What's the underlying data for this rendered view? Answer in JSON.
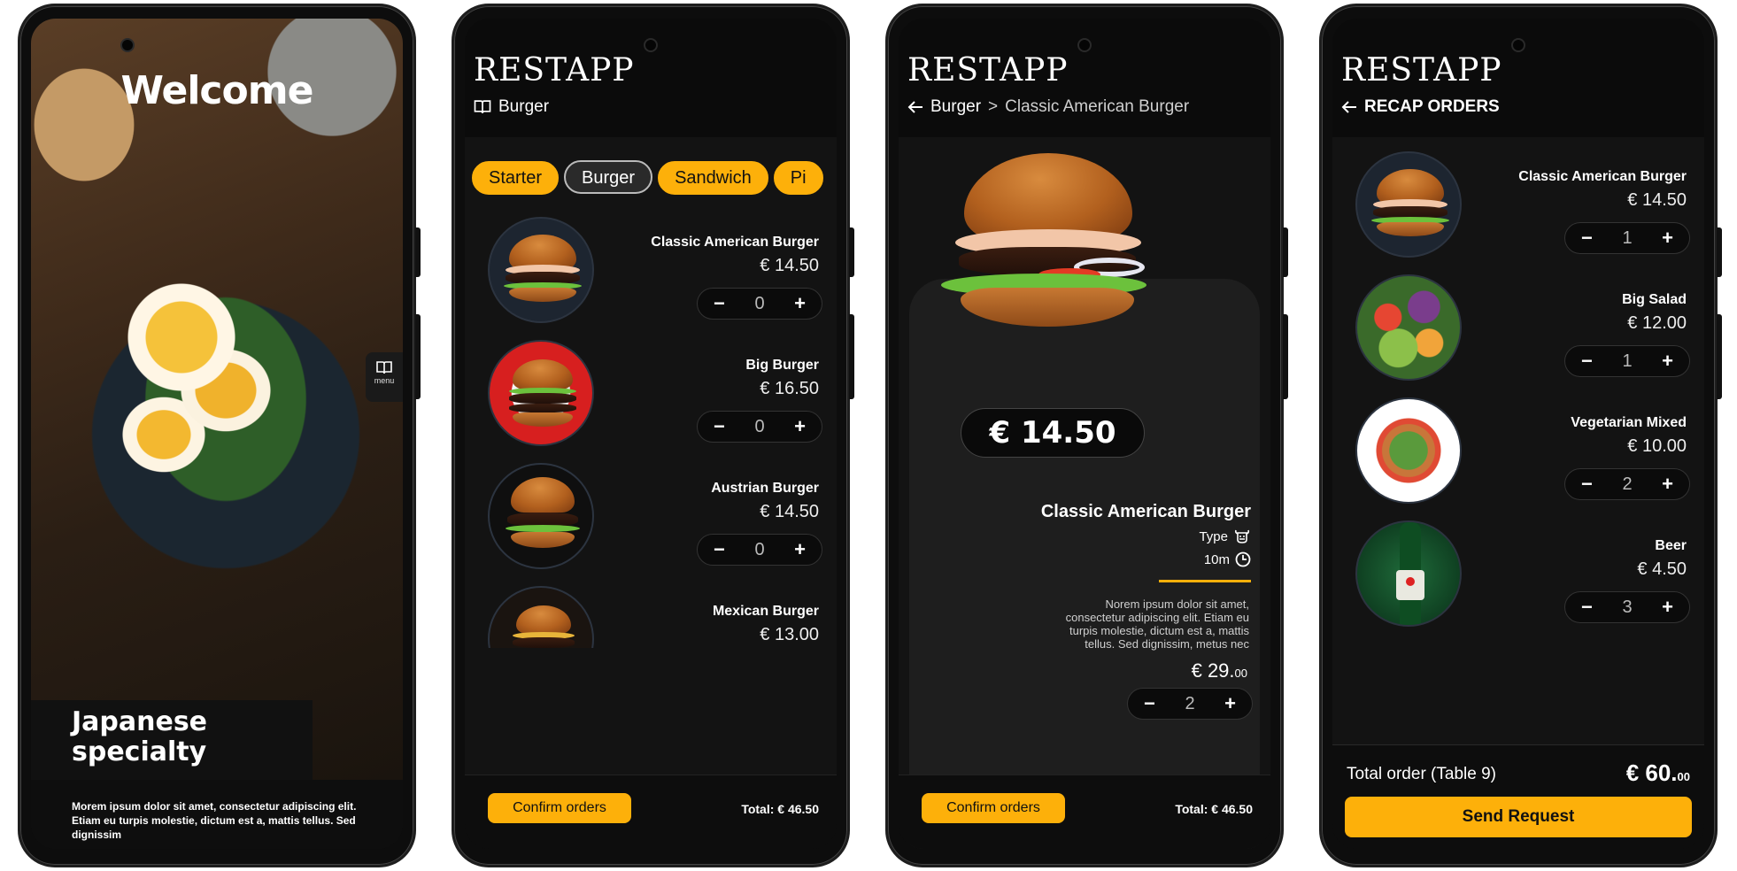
{
  "screen1": {
    "welcome": "Welcome",
    "menu_label": "menu",
    "specialty": "Japanese specialty",
    "description": "Morem ipsum dolor sit amet, consectetur adipiscing elit. Etiam eu turpis molestie, dictum est a, mattis tellus. Sed dignissim"
  },
  "screen2": {
    "brand": "RESTAPP",
    "crumb": "Burger",
    "chips": [
      "Starter",
      "Burger",
      "Sandwich",
      "Pi"
    ],
    "items": [
      {
        "name": "Classic American Burger",
        "price": "€ 14.50",
        "qty": "0"
      },
      {
        "name": "Big Burger",
        "price": "€ 16.50",
        "qty": "0"
      },
      {
        "name": "Austrian Burger",
        "price": "€ 14.50",
        "qty": "0"
      },
      {
        "name": "Mexican Burger",
        "price": "€ 13.00",
        "qty": "0"
      }
    ],
    "confirm": "Confirm orders",
    "total": "Total: € 46.50"
  },
  "screen3": {
    "brand": "RESTAPP",
    "crumb_parent": "Burger",
    "crumb_sep": ">",
    "crumb_current": "Classic American Burger",
    "price": "€ 14.50",
    "name": "Classic American Burger",
    "type_label": "Type",
    "time": "10m",
    "description": "Norem ipsum dolor sit amet, consectetur adipiscing elit. Etiam eu turpis molestie, dictum est a, mattis tellus. Sed dignissim, metus nec",
    "line_total_main": "€ 29.",
    "line_total_cents": "00",
    "qty": "2",
    "confirm": "Confirm orders",
    "total": "Total: € 46.50"
  },
  "screen4": {
    "brand": "RESTAPP",
    "crumb": "RECAP ORDERS",
    "items": [
      {
        "name": "Classic American Burger",
        "price": "€ 14.50",
        "qty": "1"
      },
      {
        "name": "Big Salad",
        "price": "€ 12.00",
        "qty": "1"
      },
      {
        "name": "Vegetarian Mixed",
        "price": "€ 10.00",
        "qty": "2"
      },
      {
        "name": "Beer",
        "price": "€ 4.50",
        "qty": "3"
      }
    ],
    "total_label": "Total order (Table 9)",
    "total_main": "€ 60.",
    "total_cents": "00",
    "send": "Send Request"
  },
  "colors": {
    "accent": "#fdb00a",
    "background": "#131313",
    "header": "#0b0b0b"
  },
  "icons": [
    "book-icon",
    "arrow-left-icon",
    "cow-icon",
    "clock-icon",
    "minus-icon",
    "plus-icon"
  ]
}
